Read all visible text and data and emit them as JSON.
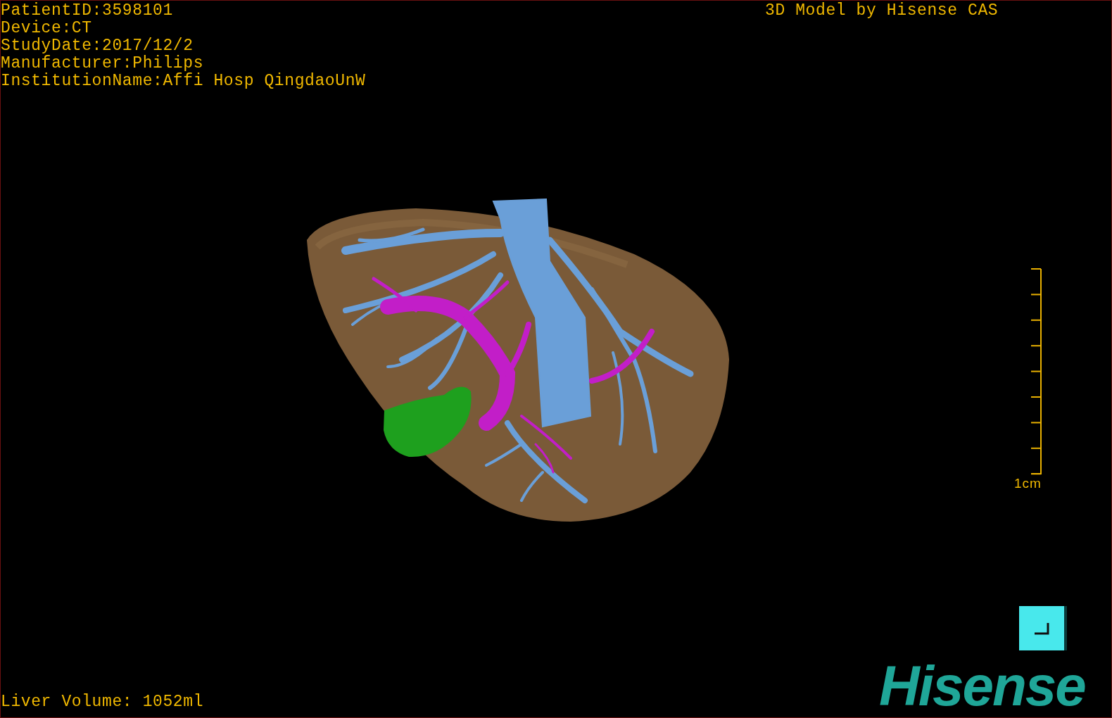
{
  "study_info": [
    "PatientID:3598101",
    "Device:CT",
    "StudyDate:2017/12/2",
    "Manufacturer:Philips",
    "InstitutionName:Affi Hosp QingdaoUnW"
  ],
  "model_caption": "3D Model by Hisense CAS",
  "scale_bar": {
    "label": "1cm"
  },
  "liver_volume": "Liver Volume: 1052ml",
  "logo": "Hisense"
}
